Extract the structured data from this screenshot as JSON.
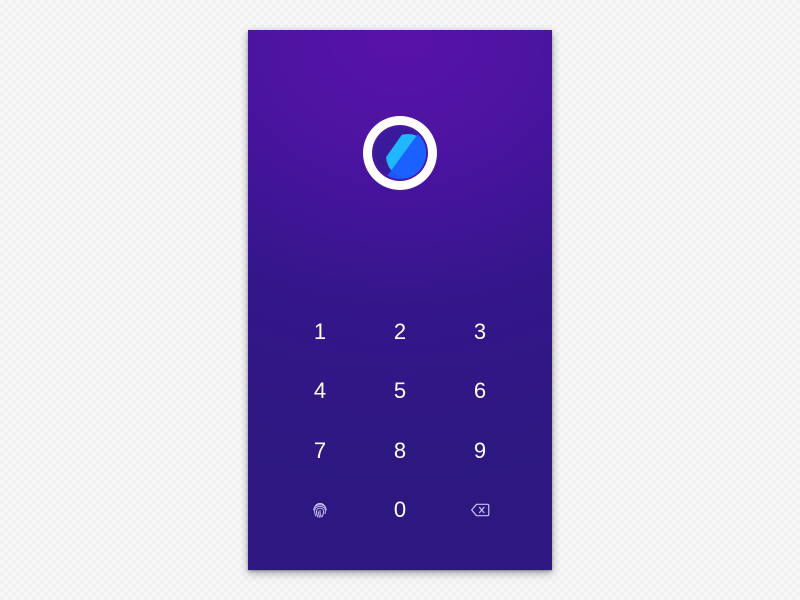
{
  "app": {
    "logo_icon": "app-logo-icon",
    "background_color": "#3a1690",
    "accent_colors": [
      "#1a5cff",
      "#1fb8ff"
    ]
  },
  "keypad": {
    "keys": [
      {
        "label": "1"
      },
      {
        "label": "2"
      },
      {
        "label": "3"
      },
      {
        "label": "4"
      },
      {
        "label": "5"
      },
      {
        "label": "6"
      },
      {
        "label": "7"
      },
      {
        "label": "8"
      },
      {
        "label": "9"
      },
      {
        "icon": "fingerprint-icon"
      },
      {
        "label": "0"
      },
      {
        "icon": "backspace-icon"
      }
    ]
  }
}
